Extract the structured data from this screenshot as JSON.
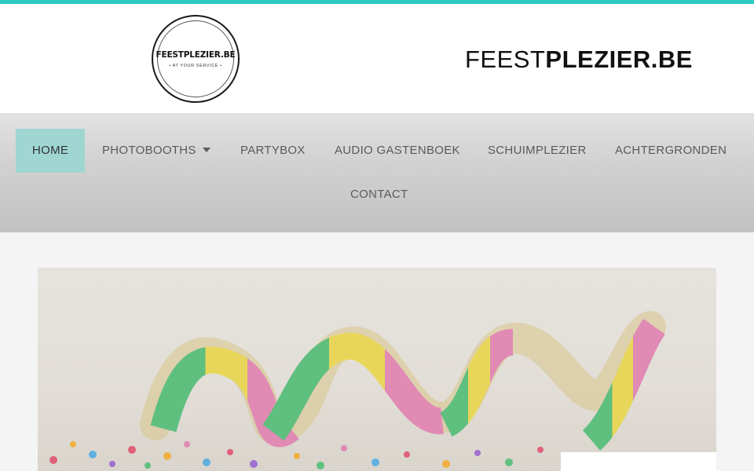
{
  "header": {
    "logo_name": "FEESTPLEZIER.BE",
    "logo_tagline": "• AT YOUR SERVICE •",
    "brand_light": "FEEST",
    "brand_bold": "PLEZIER.BE"
  },
  "nav": {
    "items": [
      {
        "label": "HOME",
        "active": true
      },
      {
        "label": "PHOTOBOOTHS",
        "has_dropdown": true
      },
      {
        "label": "PARTYBOX"
      },
      {
        "label": "AUDIO GASTENBOEK"
      },
      {
        "label": "SCHUIMPLEZIER"
      },
      {
        "label": "ACHTERGRONDEN"
      },
      {
        "label": "CONTACT"
      }
    ]
  },
  "hero": {
    "image": "party-streamer-confetti-image"
  },
  "colors": {
    "accent_topbar": "#2ccac0",
    "nav_active_bg": "#9fd6d2"
  }
}
